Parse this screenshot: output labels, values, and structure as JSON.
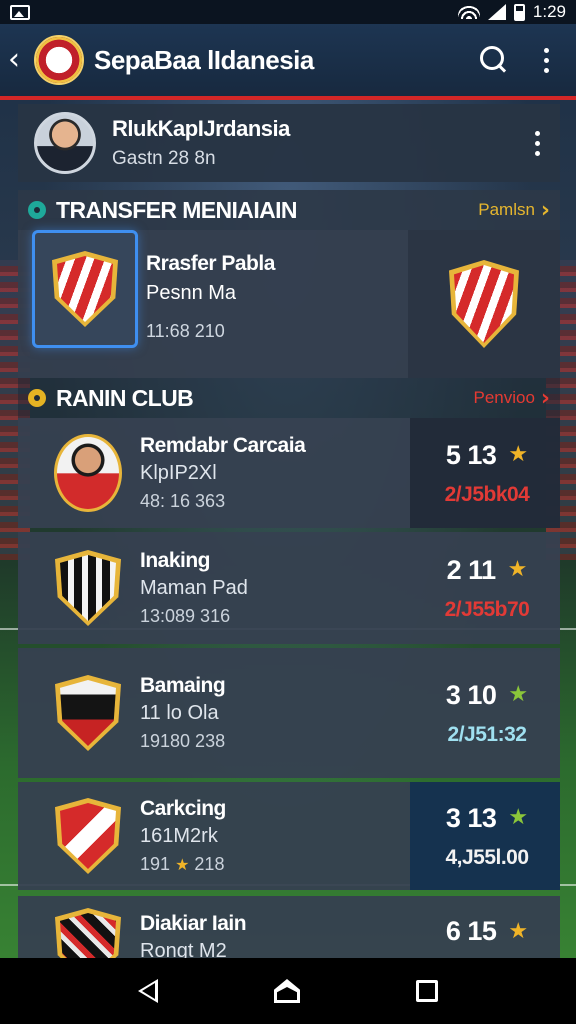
{
  "status_bar": {
    "time": "1:29"
  },
  "app_bar": {
    "title": "SepaBaa lIdanesia"
  },
  "profile": {
    "name": "RlukKapIJrdansia",
    "subtitle": "Gastn 28 8n"
  },
  "transfer_section": {
    "title": "TRANSFER MENIAIAIN",
    "link": "Pamlsn",
    "card": {
      "name": "Rrasfer Pabla",
      "subtitle": "Pesnn Ma",
      "meta": "11:68 210"
    }
  },
  "ranking_section": {
    "title": "RANIN CLUB",
    "link": "Penvioo",
    "rows": [
      {
        "name": "Remdabr Carcaia",
        "subtitle": "KlpIP2Xl",
        "meta": "48: 16 363",
        "score": "5 13",
        "amount": "2/J5bk04"
      },
      {
        "name": "Inaking",
        "subtitle": "Maman Pad",
        "meta": "13:089 316",
        "score": "2 11",
        "amount": "2/J55b70"
      },
      {
        "name": "Bamaing",
        "subtitle": "11 lo Ola",
        "meta": "19180 238",
        "score": "3 10",
        "amount": "2/J51:32"
      },
      {
        "name": "Carkcing",
        "subtitle": "161M2rk",
        "meta_left": "191",
        "meta_star": "★",
        "meta_right": "218",
        "score": "3 13",
        "amount": "4,J55l.00"
      },
      {
        "name": "Diakiar Iain",
        "subtitle": "Rongt M2",
        "score": "6 15"
      }
    ]
  },
  "colors": {
    "accent_red": "#d32727",
    "gold": "#e6b62e",
    "blue_highlight": "#3f8ff0"
  },
  "icons": [
    "back-arrow-icon",
    "search-icon",
    "more-vert-icon",
    "star-icon",
    "chevron-right-icon",
    "nav-back-icon",
    "nav-home-icon",
    "nav-recent-icon"
  ]
}
